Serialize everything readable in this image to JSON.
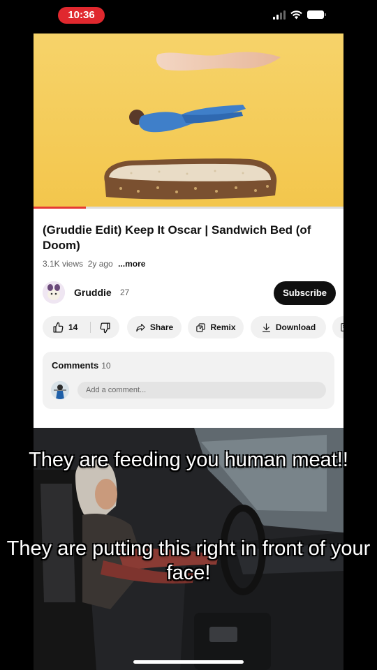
{
  "status_bar": {
    "time": "10:36",
    "icons": [
      "cellular-signal-icon",
      "wifi-icon",
      "battery-icon"
    ]
  },
  "video": {
    "title": "(Gruddie Edit) Keep It Oscar | Sandwich Bed (of Doom)",
    "views": "3.1K views",
    "age": "2y ago",
    "more_label": "...more",
    "progress": 0.17
  },
  "channel": {
    "name": "Gruddie",
    "subscribers": "27",
    "subscribe_label": "Subscribe"
  },
  "actions": {
    "likes": "14",
    "share_label": "Share",
    "remix_label": "Remix",
    "download_label": "Download",
    "icons": [
      "thumbs-up-icon",
      "thumbs-down-icon",
      "share-icon",
      "remix-icon",
      "download-icon",
      "save-icon"
    ]
  },
  "comments": {
    "label": "Comments",
    "count": "10",
    "placeholder": "Add a comment..."
  },
  "overlay": {
    "caption_top": "They are feeding you human meat!!",
    "caption_bottom": "They are putting this right in front of your face!"
  },
  "colors": {
    "thumbnail_bg": "#f7ce5a",
    "time_pill": "#e0282e",
    "progress": "#e53935",
    "subscribe_bg": "#0f0f0f"
  }
}
